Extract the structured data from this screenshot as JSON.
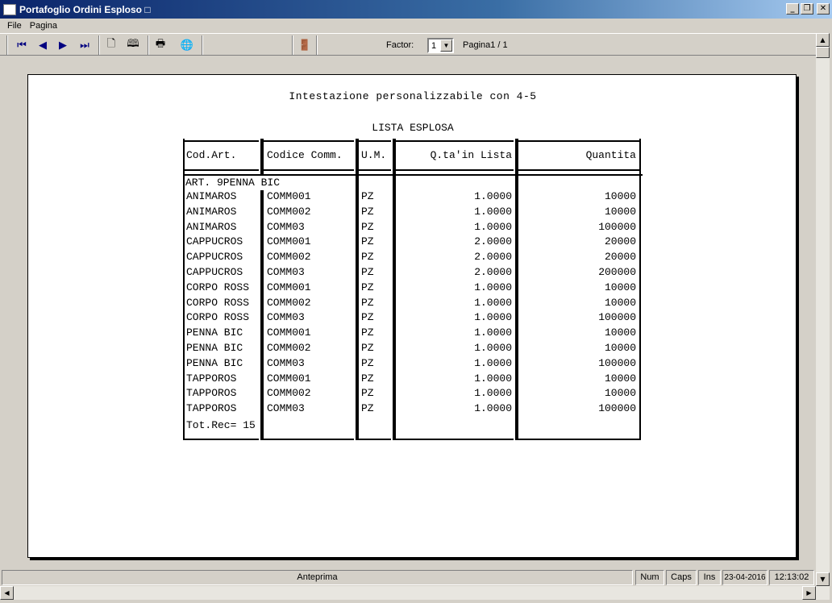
{
  "window": {
    "title": "Portafoglio Ordini Esploso □"
  },
  "menu": [
    {
      "label": "File"
    },
    {
      "label": "Pagina"
    }
  ],
  "toolbar": {
    "factor_label": "Factor:",
    "factor_value": "1",
    "page_label": "Pagina1 / 1"
  },
  "report": {
    "header": "Intestazione personalizzabile con 4-5",
    "title": "LISTA ESPLOSA",
    "columns": [
      "Cod.Art.",
      "Codice Comm.",
      "U.M.",
      "Q.ta'in Lista",
      "Quantita"
    ],
    "group_label": "ART. 9PENNA BIC",
    "rows": [
      [
        "ANIMAROS",
        "COMM001",
        "PZ",
        "1.0000",
        "10000"
      ],
      [
        "ANIMAROS",
        "COMM002",
        "PZ",
        "1.0000",
        "10000"
      ],
      [
        "ANIMAROS",
        "COMM03",
        "PZ",
        "1.0000",
        "100000"
      ],
      [
        "CAPPUCROS",
        "COMM001",
        "PZ",
        "2.0000",
        "20000"
      ],
      [
        "CAPPUCROS",
        "COMM002",
        "PZ",
        "2.0000",
        "20000"
      ],
      [
        "CAPPUCROS",
        "COMM03",
        "PZ",
        "2.0000",
        "200000"
      ],
      [
        "CORPO ROSS",
        "COMM001",
        "PZ",
        "1.0000",
        "10000"
      ],
      [
        "CORPO ROSS",
        "COMM002",
        "PZ",
        "1.0000",
        "10000"
      ],
      [
        "CORPO ROSS",
        "COMM03",
        "PZ",
        "1.0000",
        "100000"
      ],
      [
        "PENNA BIC",
        "COMM001",
        "PZ",
        "1.0000",
        "10000"
      ],
      [
        "PENNA BIC",
        "COMM002",
        "PZ",
        "1.0000",
        "10000"
      ],
      [
        "PENNA BIC",
        "COMM03",
        "PZ",
        "1.0000",
        "100000"
      ],
      [
        "TAPPOROS",
        "COMM001",
        "PZ",
        "1.0000",
        "10000"
      ],
      [
        "TAPPOROS",
        "COMM002",
        "PZ",
        "1.0000",
        "10000"
      ],
      [
        "TAPPOROS",
        "COMM03",
        "PZ",
        "1.0000",
        "100000"
      ]
    ],
    "total": "Tot.Rec= 15"
  },
  "status": {
    "mode": "Anteprima",
    "num": "Num",
    "caps": "Caps",
    "ins": "Ins",
    "date": "23-04-2016",
    "time": "12:13:02"
  }
}
